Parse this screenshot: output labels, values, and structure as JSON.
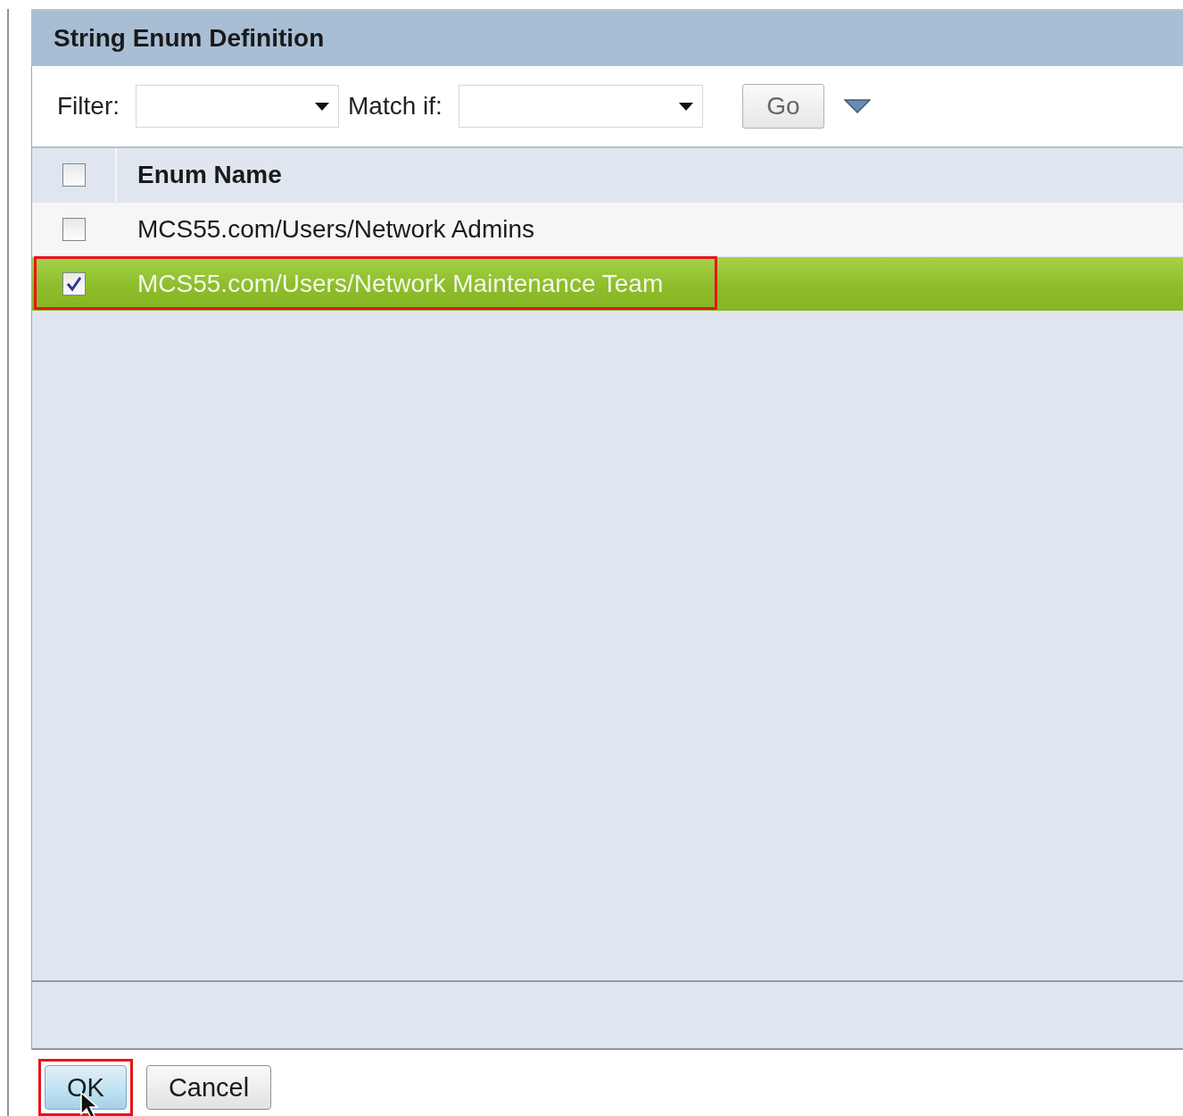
{
  "dialog": {
    "title": "String Enum Definition"
  },
  "filter_bar": {
    "filter_label": "Filter:",
    "match_label": "Match if:",
    "go_button": "Go"
  },
  "table": {
    "header": {
      "label": "Enum Name",
      "checked": false
    },
    "rows": [
      {
        "name": "MCS55.com/Users/Network Admins",
        "checked": false,
        "selected": false,
        "highlighted": false
      },
      {
        "name": "MCS55.com/Users/Network Maintenance Team",
        "checked": true,
        "selected": true,
        "highlighted": true
      }
    ]
  },
  "buttons": [
    {
      "label": "OK",
      "highlighted": true,
      "pressed": true
    },
    {
      "label": "Cancel",
      "highlighted": false,
      "pressed": false
    }
  ]
}
